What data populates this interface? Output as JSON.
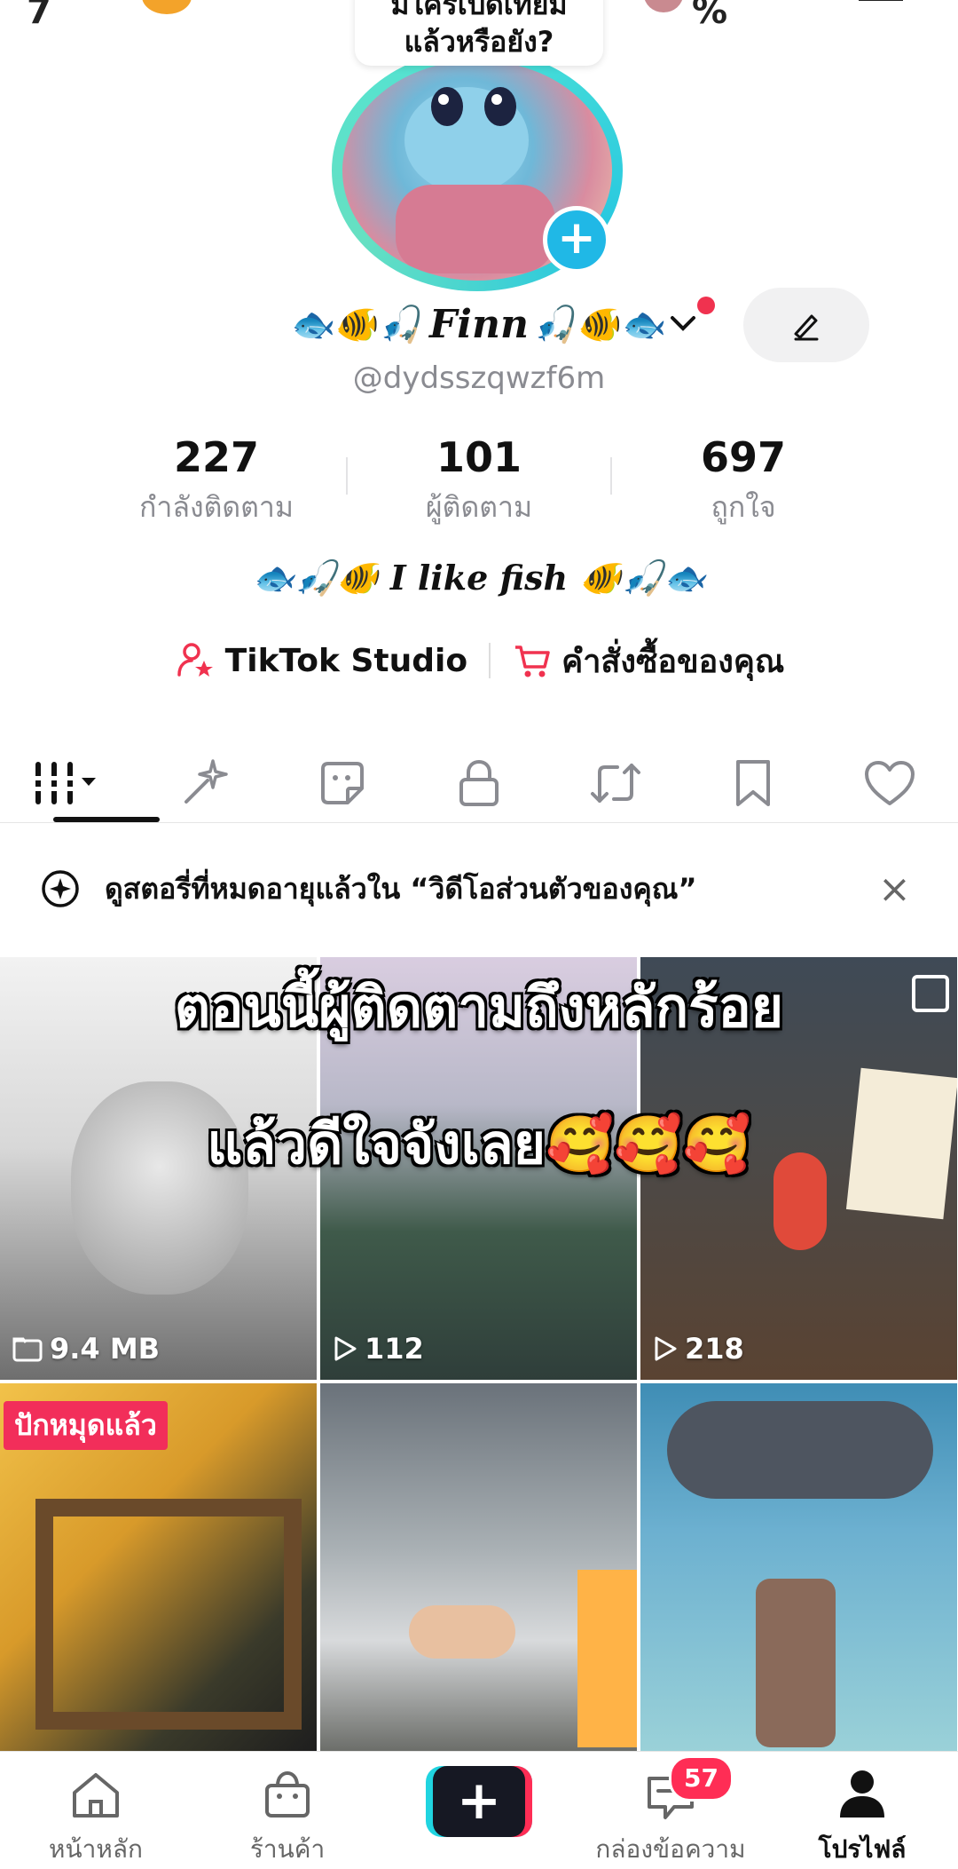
{
  "status_bar": {
    "left_fragment": "7",
    "right_fragment": "%"
  },
  "profile": {
    "prompt_bubble": "มีใครเปิดเทียม\nแล้วหรือยัง?",
    "display_name": "Finn",
    "name_emoji_left": "🐟🐠🎣",
    "name_emoji_right": "🎣🐠🐟",
    "username": "@dydsszqwzf6m",
    "bio_text": "I like fish",
    "bio_emoji_left": "🐟🎣🐠",
    "bio_emoji_right": "🐠🎣🐟",
    "stats": [
      {
        "value": "227",
        "label": "กำลังติดตาม"
      },
      {
        "value": "101",
        "label": "ผู้ติดตาม"
      },
      {
        "value": "697",
        "label": "ถูกใจ"
      }
    ],
    "links": {
      "studio": "TikTok Studio",
      "orders": "คำสั่งซื้อของคุณ"
    }
  },
  "tabs": [
    "videos-grid-icon",
    "sparkle-icon",
    "sticker-icon",
    "lock-icon",
    "repost-icon",
    "bookmark-icon",
    "heart-icon"
  ],
  "notice": {
    "text": "ดูสตอรี่ที่หมดอายุแล้วใน “วิดีโอส่วนตัวของคุณ”",
    "close": "×"
  },
  "overlay_caption": {
    "line1": "ตอนนี้ผู้ติดตามถึงหลักร้อย",
    "line2": "แล้วดีใจจังเลย🥰🥰🥰"
  },
  "grid": [
    {
      "meta": "9.4 MB",
      "meta_icon": "folder-icon"
    },
    {
      "meta": "112",
      "meta_icon": "play-icon"
    },
    {
      "meta": "218",
      "meta_icon": "play-icon"
    },
    {
      "pinned_label": "ปักหมุดแล้ว"
    },
    {},
    {}
  ],
  "nav": {
    "home": "หน้าหลัก",
    "shop": "ร้านค้า",
    "inbox": "กล่องข้อความ",
    "inbox_badge": "57",
    "profile": "โปรไฟล์"
  },
  "colors": {
    "accent": "#ff2d55",
    "teal": "#20d4e0",
    "muted": "#8a8b91"
  }
}
